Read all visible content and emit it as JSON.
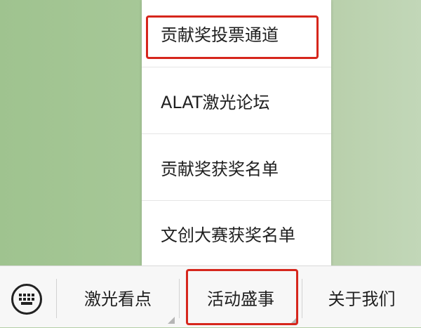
{
  "menu": {
    "items": [
      {
        "label": "贡献奖投票通道"
      },
      {
        "label": "ALAT激光论坛"
      },
      {
        "label": "贡献奖获奖名单"
      },
      {
        "label": "文创大赛获奖名单"
      }
    ]
  },
  "bottom_bar": {
    "keyboard_icon": "keyboard-icon",
    "tabs": [
      {
        "label": "激光看点",
        "has_submenu": true
      },
      {
        "label": "活动盛事",
        "has_submenu": true
      },
      {
        "label": "关于我们",
        "has_submenu": false
      }
    ]
  },
  "colors": {
    "highlight": "#d6261c",
    "background": "#a9c99a"
  }
}
